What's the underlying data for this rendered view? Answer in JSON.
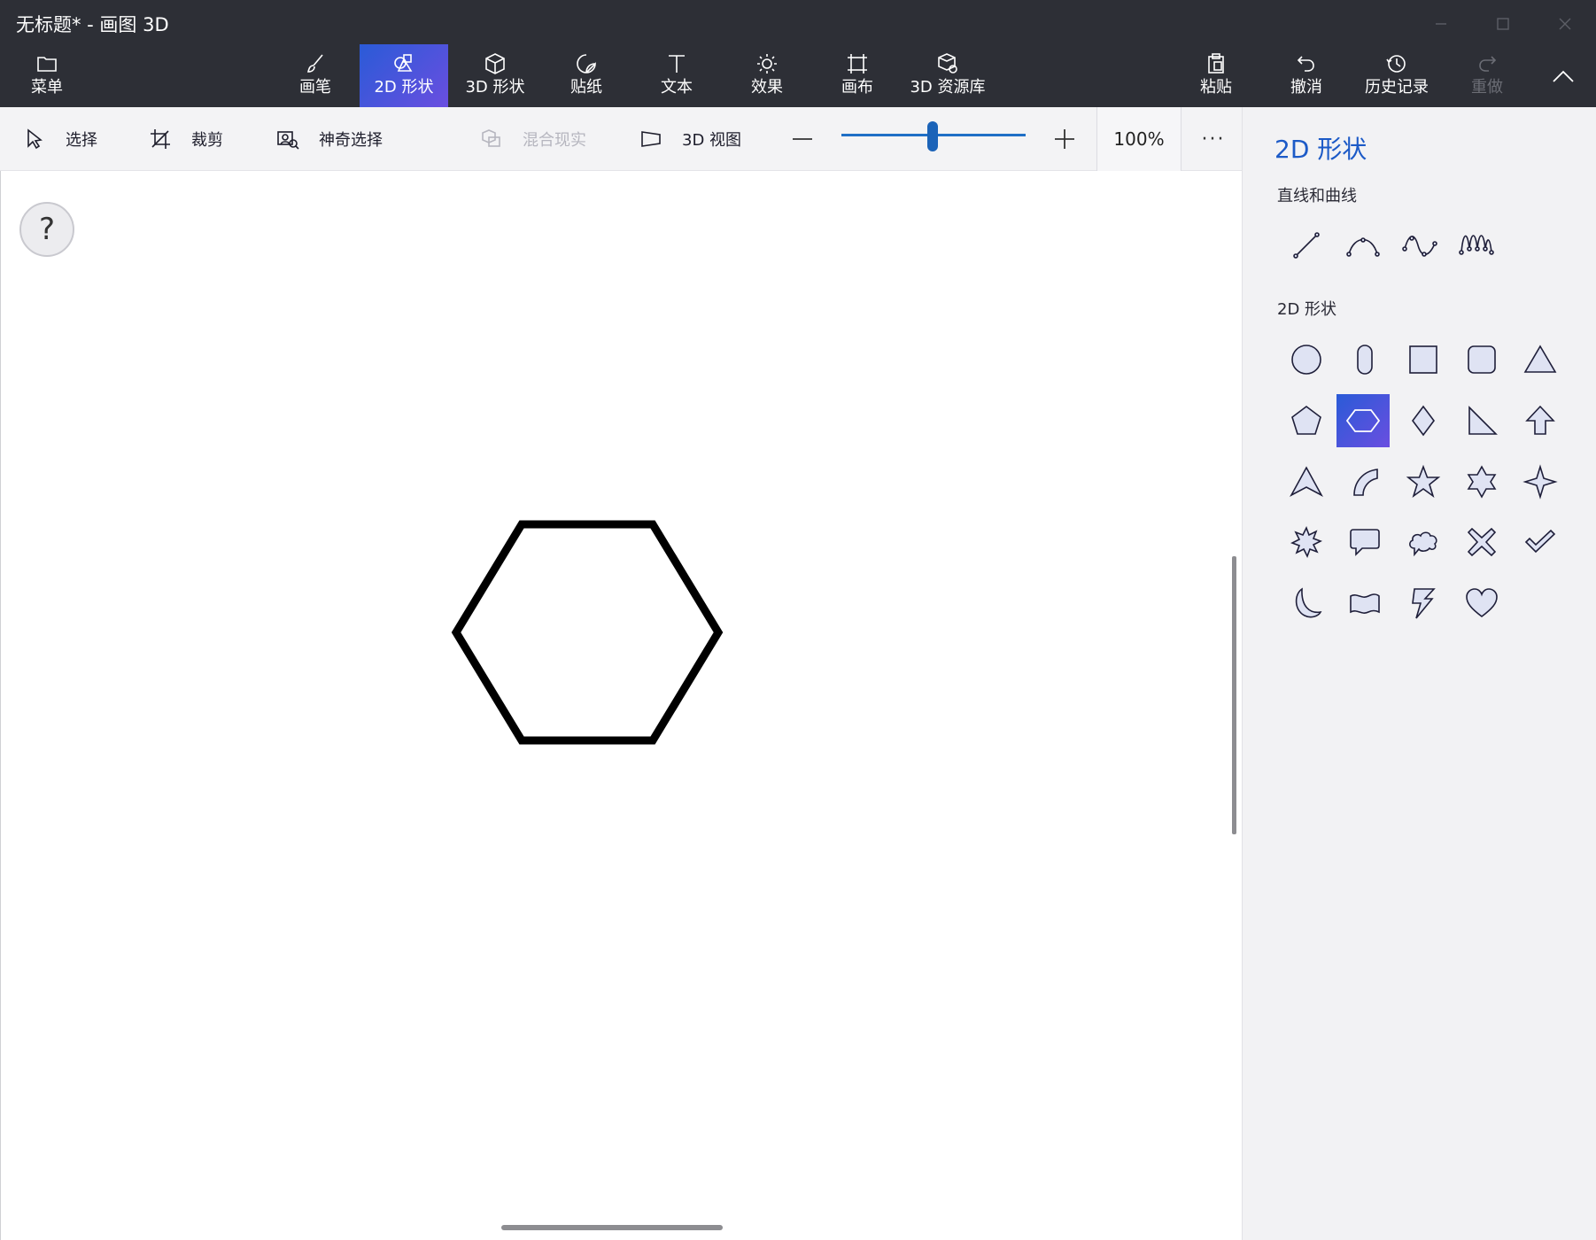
{
  "window": {
    "title": "无标题* - 画图 3D"
  },
  "ribbon": {
    "menu": "菜单",
    "brushes": "画笔",
    "shapes_2d": "2D 形状",
    "shapes_3d": "3D 形状",
    "stickers": "贴纸",
    "text": "文本",
    "effects": "效果",
    "canvas": "画布",
    "library_3d": "3D 资源库",
    "paste": "粘贴",
    "undo": "撤消",
    "history": "历史记录",
    "redo": "重做",
    "active_tab": "2D 形状"
  },
  "toolbar": {
    "select": "选择",
    "crop": "裁剪",
    "magic_select": "神奇选择",
    "mixed_reality": "混合现实",
    "view_3d": "3D 视图",
    "zoom_label": "100%",
    "zoom_value": 100,
    "more": "···"
  },
  "canvas": {
    "help": "?",
    "shape": "hexagon"
  },
  "panel": {
    "title": "2D 形状",
    "lines_section": "直线和曲线",
    "shapes_section": "2D 形状",
    "line_tools": [
      "line",
      "curve-1",
      "curve-2",
      "curve-3"
    ],
    "shape_tools": [
      "circle",
      "capsule",
      "square",
      "rounded-square",
      "triangle",
      "pentagon",
      "hexagon",
      "diamond",
      "right-triangle",
      "arrow-up",
      "arrowhead",
      "quarter-circle",
      "star-5",
      "star-6",
      "star-4",
      "burst",
      "speech-bubble",
      "thought-cloud",
      "x-mark",
      "checkmark",
      "moon",
      "banner",
      "lightning",
      "heart"
    ],
    "selected_shape": "hexagon"
  },
  "colors": {
    "titlebar_bg": "#2d2f36",
    "accent_gradient_start": "#2a5bd7",
    "accent_gradient_end": "#6a4ee0",
    "panel_title": "#1c5ac7",
    "shape_fill": "#dfe3f3",
    "shape_stroke": "#1f1f3a"
  }
}
